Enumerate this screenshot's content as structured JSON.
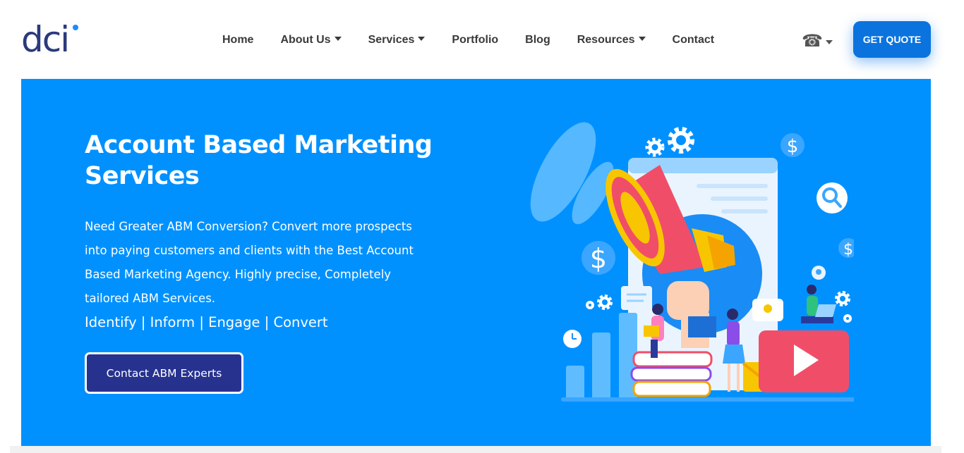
{
  "brand": {
    "logo_text": "dci",
    "logo_color": "#2a3a7c",
    "logo_dot_color": "#1a8cff"
  },
  "nav": {
    "items": [
      {
        "label": "Home",
        "dropdown": false
      },
      {
        "label": "About Us",
        "dropdown": true
      },
      {
        "label": "Services",
        "dropdown": true
      },
      {
        "label": "Portfolio",
        "dropdown": false
      },
      {
        "label": "Blog",
        "dropdown": false
      },
      {
        "label": "Resources",
        "dropdown": true
      },
      {
        "label": "Contact",
        "dropdown": false
      }
    ],
    "phone_icon": "☎",
    "cta_label": "GET QUOTE",
    "cta_color": "#0b73de"
  },
  "hero": {
    "background": "#0091ff",
    "title": "Account Based Marketing Services",
    "description": "Need Greater ABM Conversion? Convert more prospects into paying customers and clients with the Best Account Based Marketing Agency. Highly precise, Completely tailored ABM Services.",
    "tagline": "Identify | Inform | Engage | Convert",
    "button_label": "Contact ABM Experts",
    "button_color": "#27328f"
  },
  "illustration": {
    "icons": [
      "megaphone-icon",
      "dollar-icon",
      "gear-icon",
      "search-icon",
      "lightbulb-icon",
      "play-icon",
      "envelope-icon",
      "clock-icon",
      "bar-chart-icon"
    ],
    "dollar_symbol": "$"
  }
}
